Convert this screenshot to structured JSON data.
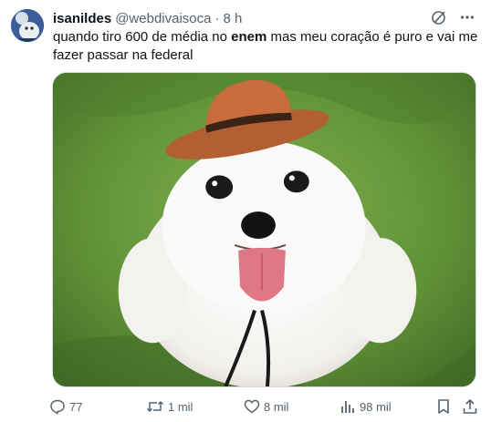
{
  "tweet": {
    "display_name": "isanildes",
    "handle": "@webdivaisoca",
    "separator": "·",
    "time": "8 h",
    "text_before": "quando tiro 600 de média no ",
    "text_bold": "enem",
    "text_after": " mas meu coração é puro e vai me fazer passar na federal",
    "media_icon": "dog-with-hat-photo"
  },
  "top_icons": [
    "grok-icon",
    "more-icon"
  ],
  "actions": {
    "replies": "77",
    "reposts": "1 mil",
    "likes": "8 mil",
    "views": "98 mil"
  },
  "colors": {
    "text": "#0f1419",
    "secondary": "#536471",
    "border": "#cfd9de"
  }
}
